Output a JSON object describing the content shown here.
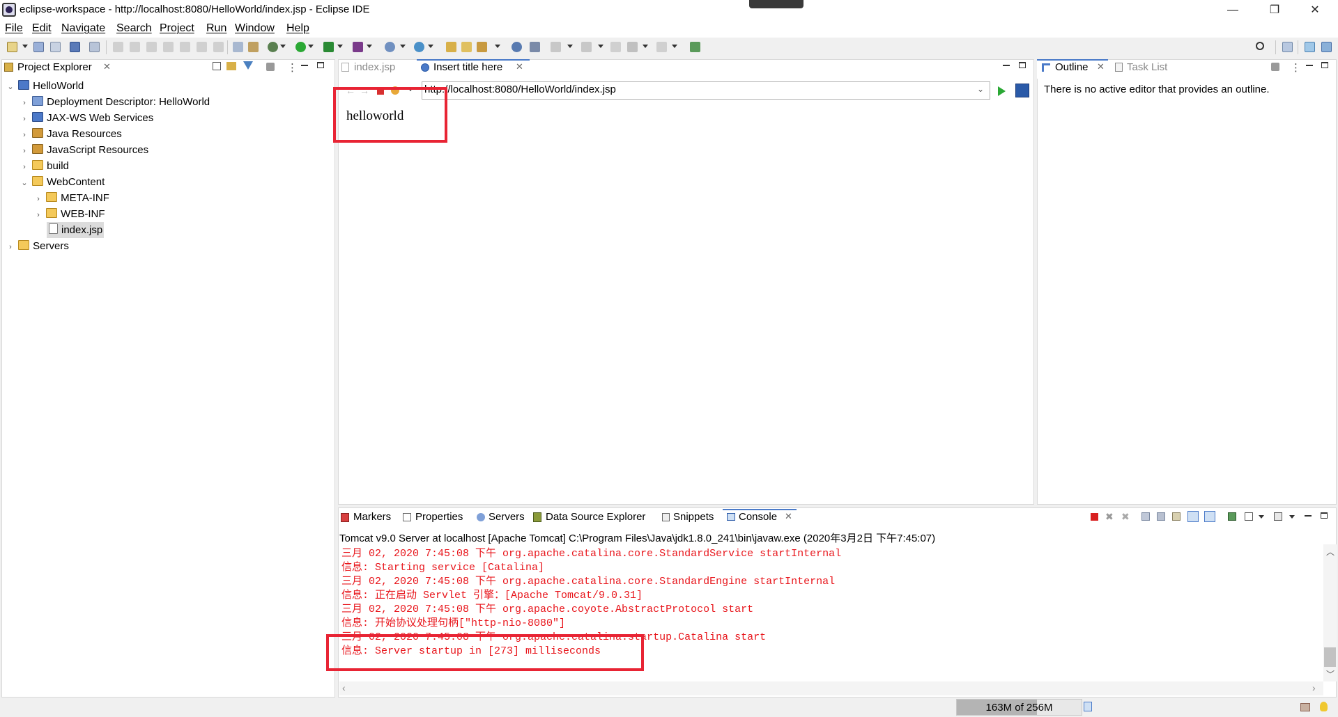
{
  "window": {
    "title": "eclipse-workspace - http://localhost:8080/HelloWorld/index.jsp - Eclipse IDE",
    "minimize": "—",
    "restore": "❐",
    "close": "✕"
  },
  "menu": [
    "File",
    "Edit",
    "Navigate",
    "Search",
    "Project",
    "Run",
    "Window",
    "Help"
  ],
  "project_explorer": {
    "title": "Project Explorer",
    "tree": [
      {
        "label": "HelloWorld",
        "indent": 0,
        "twisty": "expanded",
        "icon": "project"
      },
      {
        "label": "Deployment Descriptor: HelloWorld",
        "indent": 1,
        "twisty": "collapsed",
        "icon": "descriptor"
      },
      {
        "label": "JAX-WS Web Services",
        "indent": 1,
        "twisty": "collapsed",
        "icon": "webservice"
      },
      {
        "label": "Java Resources",
        "indent": 1,
        "twisty": "collapsed",
        "icon": "jar"
      },
      {
        "label": "JavaScript Resources",
        "indent": 1,
        "twisty": "collapsed",
        "icon": "jar"
      },
      {
        "label": "build",
        "indent": 1,
        "twisty": "collapsed",
        "icon": "folder"
      },
      {
        "label": "WebContent",
        "indent": 1,
        "twisty": "expanded",
        "icon": "folder"
      },
      {
        "label": "META-INF",
        "indent": 2,
        "twisty": "collapsed",
        "icon": "folder"
      },
      {
        "label": "WEB-INF",
        "indent": 2,
        "twisty": "collapsed",
        "icon": "folder"
      },
      {
        "label": "index.jsp",
        "indent": 2,
        "twisty": "none",
        "icon": "file",
        "selected": true
      },
      {
        "label": "Servers",
        "indent": 0,
        "twisty": "collapsed",
        "icon": "servers"
      }
    ]
  },
  "editor": {
    "tabs": [
      {
        "label": "index.jsp",
        "active": false
      },
      {
        "label": "Insert title here",
        "active": true
      }
    ],
    "url": "http://localhost:8080/HelloWorld/index.jsp",
    "page_text": "helloworld"
  },
  "outline": {
    "tabs": [
      "Outline",
      "Task List"
    ],
    "message": "There is no active editor that provides an outline."
  },
  "bottom": {
    "tabs": [
      "Markers",
      "Properties",
      "Servers",
      "Data Source Explorer",
      "Snippets",
      "Console"
    ],
    "active_tab": "Console",
    "console_header": "Tomcat v9.0 Server at localhost [Apache Tomcat] C:\\Program Files\\Java\\jdk1.8.0_241\\bin\\javaw.exe (2020年3月2日 下午7:45:07)",
    "console_lines": [
      "三月 02, 2020 7:45:08 下午 org.apache.catalina.core.StandardService startInternal",
      "信息: Starting service [Catalina]",
      "三月 02, 2020 7:45:08 下午 org.apache.catalina.core.StandardEngine startInternal",
      "信息: 正在启动 Servlet 引擎：[Apache Tomcat/9.0.31]",
      "三月 02, 2020 7:45:08 下午 org.apache.coyote.AbstractProtocol start",
      "信息: 开始协议处理句柄[\"http-nio-8080\"]",
      "三月 02, 2020 7:45:08 下午 org.apache.catalina.startup.Catalina start",
      "信息: Server startup in [273] milliseconds"
    ],
    "console_color": "#e8151b"
  },
  "status": {
    "heap": "163M of 256M",
    "heap_used_fraction": 0.64
  },
  "colors": {
    "highlight_box": "#e82434"
  }
}
